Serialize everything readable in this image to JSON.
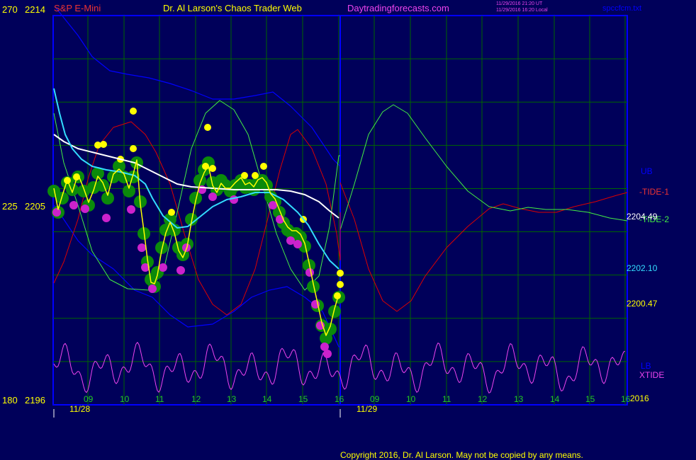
{
  "header": {
    "symbol": "S&P E-Mini",
    "title": "Dr. Al Larson's Chaos Trader Web",
    "site": "Daytradingforecasts.com",
    "timestamp_utc": "11/29/2016 21:20 UT",
    "timestamp_local": "11/29/2016 16:20 Local",
    "file": "spccfcm.txt"
  },
  "y_axis": {
    "top_left": "270",
    "top_right": "2214",
    "mid_left": "225",
    "mid_right": "2205",
    "bottom_left": "180",
    "bottom_right": "2196"
  },
  "legend": {
    "ub": "UB",
    "tide1": "-TIDE-1",
    "tide2": "-TIDE-2",
    "lb": "LB",
    "xtide": "XTIDE"
  },
  "price_labels": {
    "p1": "2204.49",
    "p2": "2202.10",
    "p3": "2200.47"
  },
  "x_axis": {
    "hour_ticks": [
      "09",
      "10",
      "11",
      "12",
      "13",
      "14",
      "15",
      "16",
      "09",
      "10",
      "11",
      "12",
      "13",
      "14",
      "15",
      "16"
    ],
    "dates": [
      "11/28",
      "11/29"
    ],
    "year": "2016"
  },
  "footer": {
    "copyright": "Copyright 2016, Dr. Al Larson. May not be copied by any means."
  },
  "colors": {
    "background": "#00005a",
    "frame": "#0000ff",
    "price": "#ffff00",
    "ema_cyan": "#33ddff",
    "ma_white": "#ffffff",
    "tide1": "#dd0000",
    "tide2": "#44ee44",
    "band": "#0000ff",
    "xtide": "#ee44ee",
    "dot_green": "#0b8a0b",
    "dot_yellow": "#ffff00",
    "dot_magenta": "#cc22cc"
  },
  "chart_data": {
    "type": "line",
    "title": "S&P E-Mini",
    "ylim": [
      2196,
      2214
    ],
    "x": [
      "09",
      "10",
      "11",
      "12",
      "13",
      "14",
      "15",
      "16"
    ],
    "series": [
      {
        "name": "price",
        "values": [
          2205.6,
          2206.8,
          2202.0,
          2206.2,
          2206.3,
          2206.2,
          2204.4,
          2201.0
        ]
      },
      {
        "name": "-TIDE-1",
        "values": [
          2202.0,
          2208.9,
          2202.0,
          2202.7,
          2207.3,
          2208.5,
          2201.2,
          2208.0
        ]
      },
      {
        "name": "-TIDE-2",
        "values": [
          2207.0,
          2202.0,
          2203.0,
          2212.0,
          2206.5,
          2204.1,
          2201.2,
          2209.0
        ]
      },
      {
        "name": "XTIDE",
        "values": [
          2198.9,
          2197.4,
          2198.7,
          2197.5,
          2198.4,
          2197.2,
          2198.9,
          2197.6
        ]
      }
    ],
    "price_levels": [
      2204.49,
      2202.1,
      2200.47
    ]
  }
}
